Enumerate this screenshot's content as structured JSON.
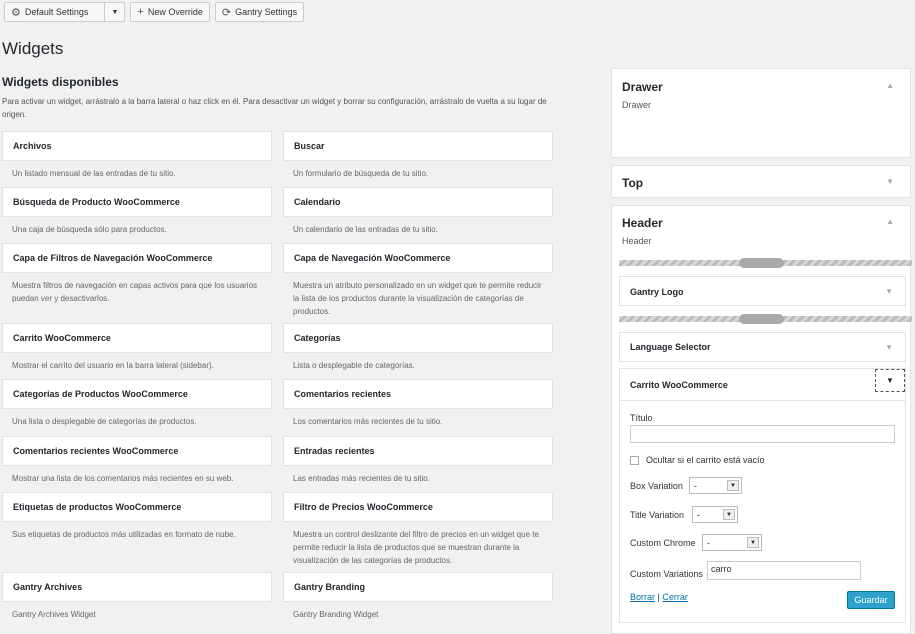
{
  "toolbar": {
    "default_settings": "Default Settings",
    "new_override": "New Override",
    "gantry_settings": "Gantry Settings"
  },
  "page_title": "Widgets",
  "available": {
    "heading": "Widgets disponibles",
    "description": "Para activar un widget, arrástralo a la barra lateral o haz click en él. Para desactivar un widget y borrar su configuración, arrástralo de vuelta a su lugar de origen."
  },
  "widgets_left": [
    {
      "title": "Archivos",
      "desc": "Un listado mensual de las entradas de tu sitio."
    },
    {
      "title": "Búsqueda de Producto WooCommerce",
      "desc": "Una caja de búsqueda sólo para productos."
    },
    {
      "title": "Capa de Filtros de Navegación WooCommerce",
      "desc": "Muestra filtros de navegación en capas activos para que los usuarios puedan ver y desactivarlos."
    },
    {
      "title": "Carrito WooCommerce",
      "desc": "Mostrar el carrito del usuario en la barra lateral (sidebar)."
    },
    {
      "title": "Categorías de Productos WooCommerce",
      "desc": "Una lista o desplegable de categorías de productos."
    },
    {
      "title": "Comentarios recientes WooCommerce",
      "desc": "Mostrar una lista de los comentarios más recientes en su web."
    },
    {
      "title": "Etiquetas de productos WooCommerce",
      "desc": "Sus etiquetas de productos más utilizadas en formato de nube."
    },
    {
      "title": "Gantry Archives",
      "desc": "Gantry Archives Widget"
    }
  ],
  "widgets_right": [
    {
      "title": "Buscar",
      "desc": "Un formulario de búsqueda de tu sitio."
    },
    {
      "title": "Calendario",
      "desc": "Un calendario de las entradas de tu sitio."
    },
    {
      "title": "Capa de Navegación WooCommerce",
      "desc": "Muestra un atributo personalizado en un widget que te permite reducir la lista de los productos durante la visualización de categorías de productos."
    },
    {
      "title": "Categorías",
      "desc": "Lista o desplegable de categorías."
    },
    {
      "title": "Comentarios recientes",
      "desc": "Los comentarios más recientes de tu sitio."
    },
    {
      "title": "Entradas recientes",
      "desc": "Las entradas más recientes de tu sitio."
    },
    {
      "title": "Filtro de Precios WooCommerce",
      "desc": "Muestra un control deslizante del filtro de precios en un widget que te permite reducir la lista de productos que se muestran durante la visualización de las categorías de productos."
    },
    {
      "title": "Gantry Branding",
      "desc": "Gantry Branding Widget"
    }
  ],
  "sidebar": {
    "drawer": {
      "title": "Drawer",
      "desc": "Drawer"
    },
    "top": {
      "title": "Top"
    },
    "header": {
      "title": "Header",
      "desc": "Header"
    },
    "header_widgets": [
      "Gantry Logo",
      "Language Selector",
      "Carrito WooCommerce"
    ],
    "form": {
      "titulo_label": "Título",
      "titulo_value": "",
      "hide_label": "Ocultar si el carrito está vacío",
      "box_variation_label": "Box Variation",
      "box_variation_value": "-",
      "title_variation_label": "Title Variation",
      "title_variation_value": "-",
      "custom_chrome_label": "Custom Chrome",
      "custom_chrome_value": "-",
      "custom_variations_label": "Custom Variations",
      "custom_variations_value": "carro",
      "borrar": "Borrar",
      "separator": "|",
      "cerrar": "Cerrar",
      "guardar": "Guardar"
    }
  },
  "colors": {
    "accent": "#2ea2cc",
    "link": "#0073aa"
  }
}
